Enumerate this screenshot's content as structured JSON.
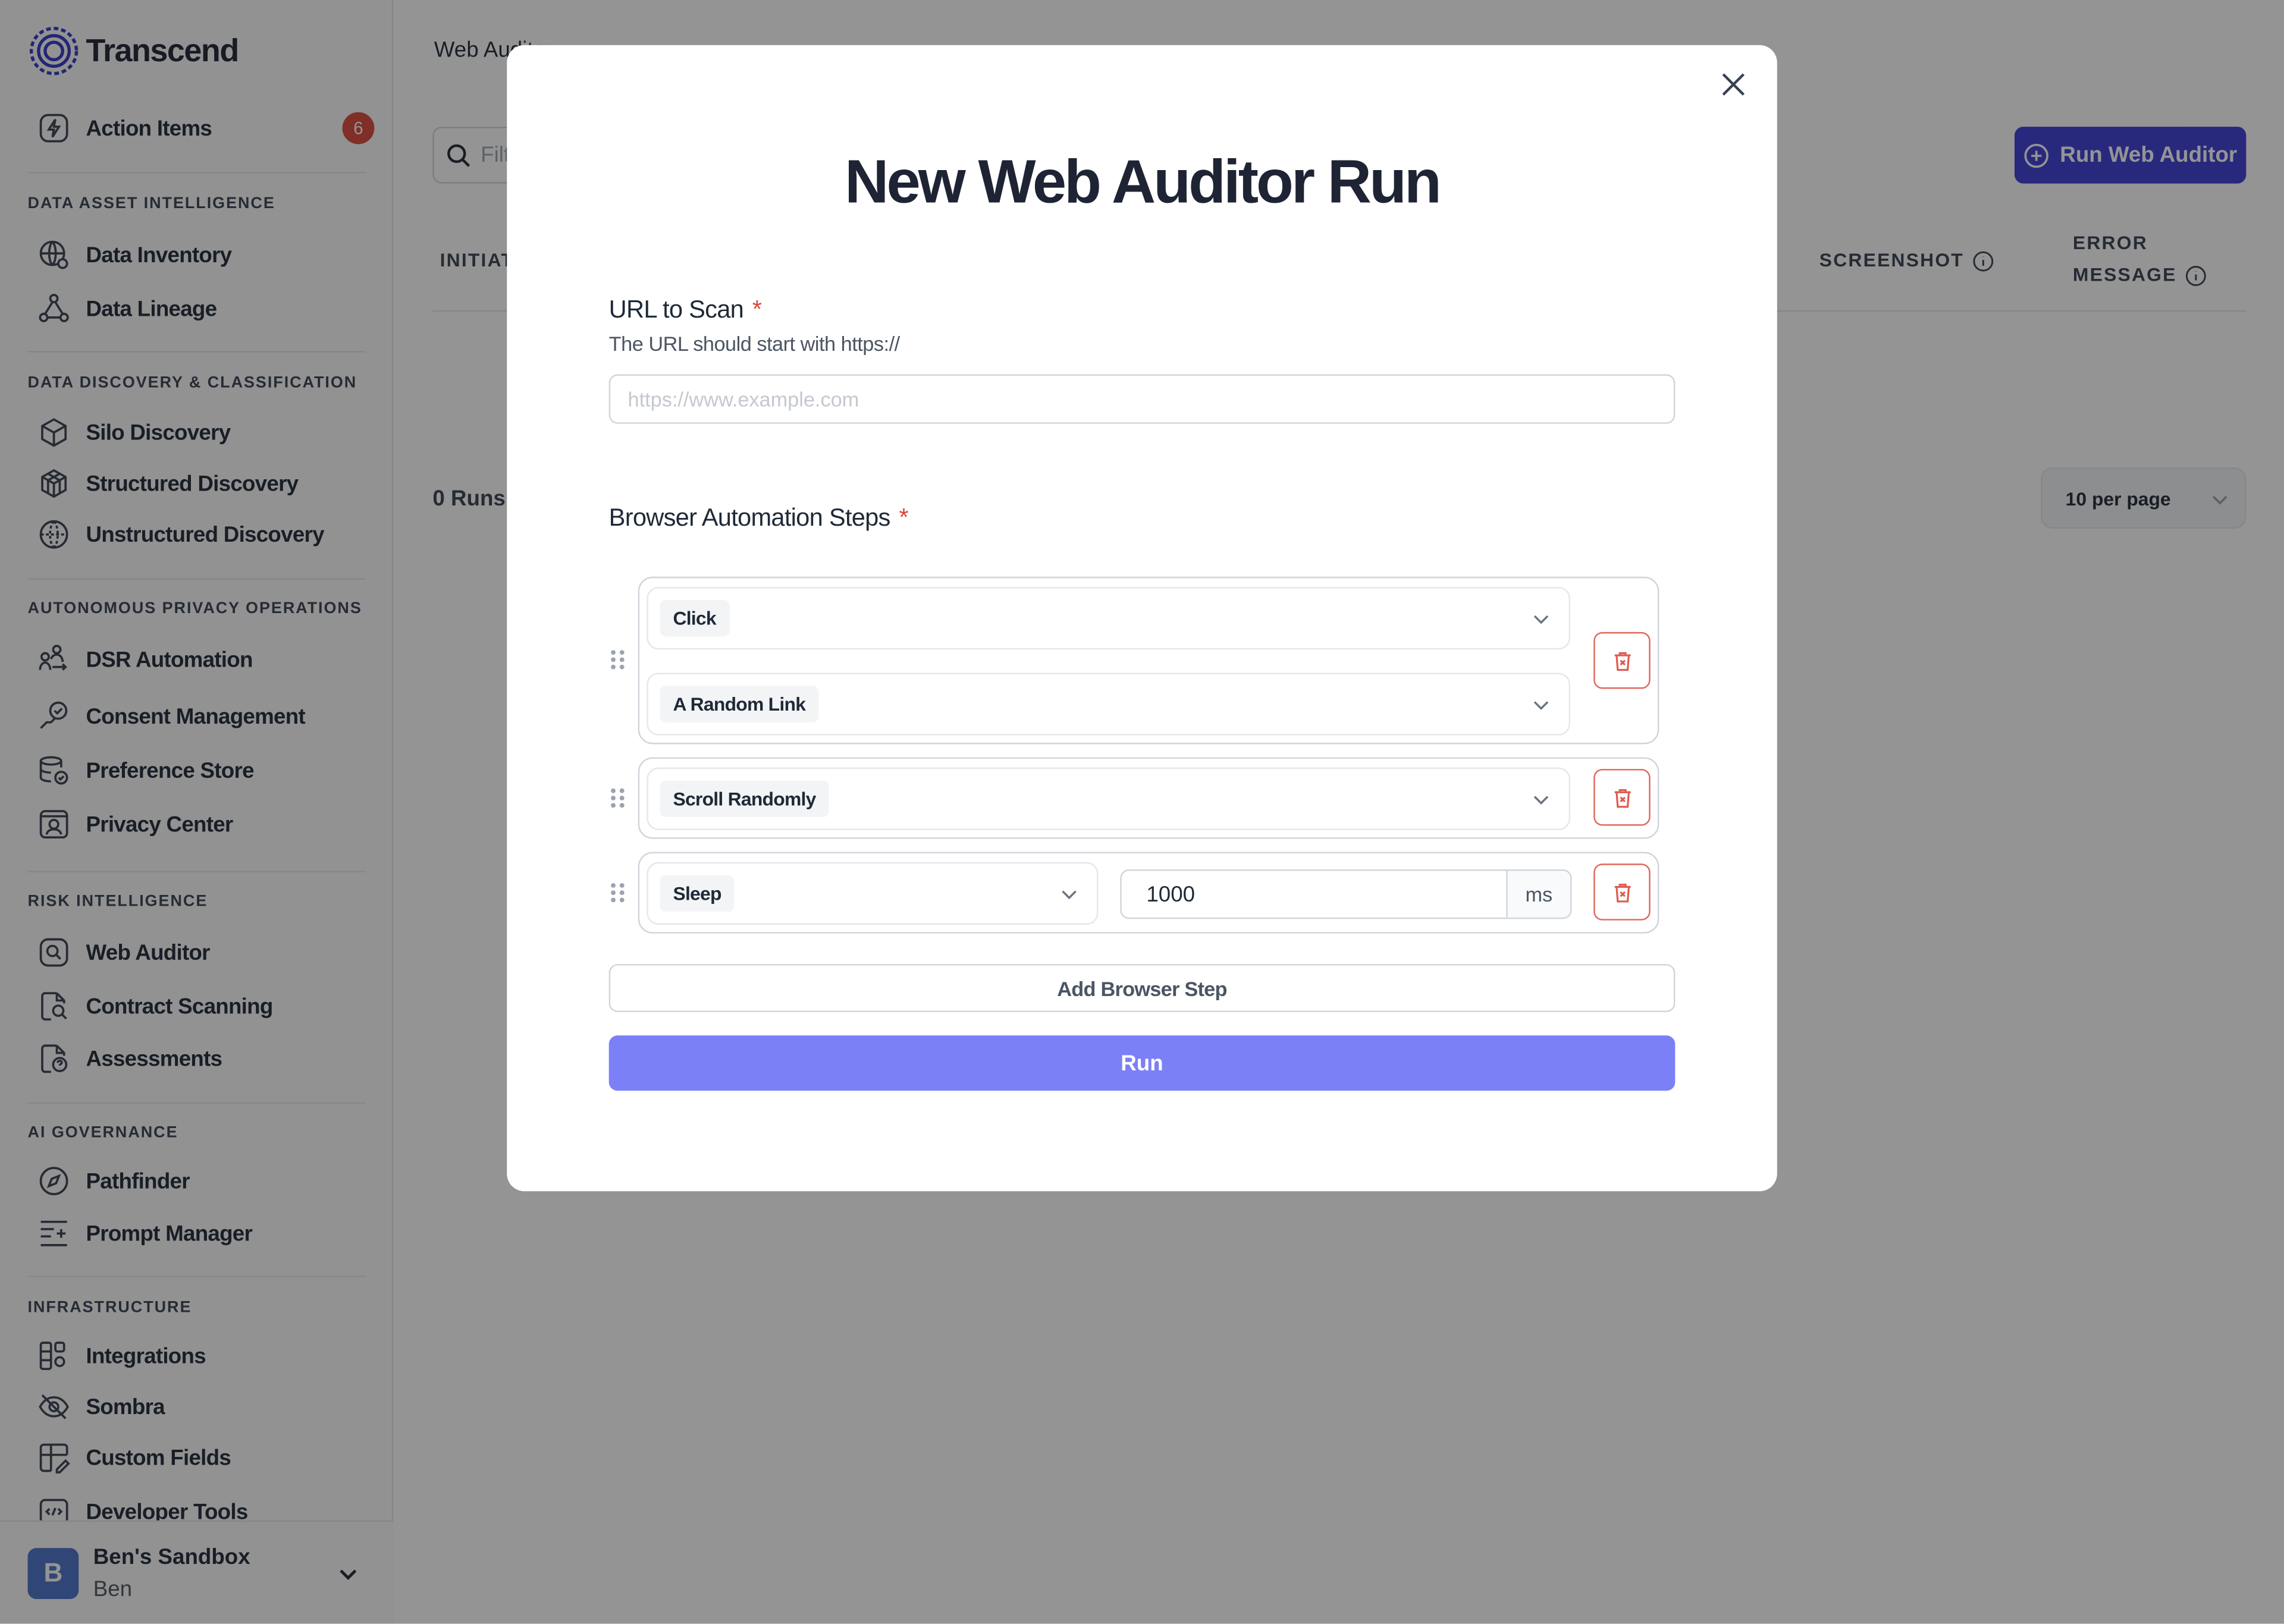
{
  "brand": {
    "name": "Transcend"
  },
  "sidebar": {
    "action_items": {
      "label": "Action Items",
      "badge": "6"
    },
    "sections": [
      {
        "title": "DATA ASSET INTELLIGENCE",
        "items": [
          {
            "label": "Data Inventory",
            "icon": "globe-gear-icon"
          },
          {
            "label": "Data Lineage",
            "icon": "lineage-nodes-icon"
          }
        ]
      },
      {
        "title": "DATA DISCOVERY & CLASSIFICATION",
        "items": [
          {
            "label": "Silo Discovery",
            "icon": "cube-icon"
          },
          {
            "label": "Structured Discovery",
            "icon": "cube-grid-icon"
          },
          {
            "label": "Unstructured Discovery",
            "icon": "globe-dashed-icon"
          }
        ]
      },
      {
        "title": "AUTONOMOUS PRIVACY OPERATIONS",
        "items": [
          {
            "label": "DSR Automation",
            "icon": "people-network-icon"
          },
          {
            "label": "Consent Management",
            "icon": "consent-check-icon"
          },
          {
            "label": "Preference Store",
            "icon": "database-check-icon"
          },
          {
            "label": "Privacy Center",
            "icon": "user-card-icon"
          }
        ]
      },
      {
        "title": "RISK INTELLIGENCE",
        "items": [
          {
            "label": "Web Auditor",
            "icon": "search-square-icon"
          },
          {
            "label": "Contract Scanning",
            "icon": "document-search-icon"
          },
          {
            "label": "Assessments",
            "icon": "document-question-icon"
          }
        ]
      },
      {
        "title": "AI GOVERNANCE",
        "items": [
          {
            "label": "Pathfinder",
            "icon": "compass-icon"
          },
          {
            "label": "Prompt Manager",
            "icon": "prompt-lines-icon"
          }
        ]
      },
      {
        "title": "INFRASTRUCTURE",
        "items": [
          {
            "label": "Integrations",
            "icon": "integrations-grid-icon"
          },
          {
            "label": "Sombra",
            "icon": "eye-off-icon"
          },
          {
            "label": "Custom Fields",
            "icon": "layout-edit-icon"
          },
          {
            "label": "Developer Tools",
            "icon": "code-window-icon"
          }
        ]
      }
    ],
    "account": {
      "initial": "B",
      "name": "Ben's Sandbox",
      "user": "Ben"
    }
  },
  "main": {
    "breadcrumb": "Web Auditor",
    "filter_placeholder": "Filter",
    "run_button": "Run Web Auditor",
    "columns": {
      "initiated": "INITIATED",
      "screenshot": "SCREENSHOT",
      "error_line1": "ERROR",
      "error_line2": "MESSAGE"
    },
    "runs_count": "0 Runs",
    "per_page": "10 per page"
  },
  "modal": {
    "title": "New Web Auditor Run",
    "url_label": "URL to Scan",
    "required_mark": "*",
    "url_help": "The URL should start with https://",
    "url_placeholder": "https://www.example.com",
    "steps_label": "Browser Automation Steps",
    "steps": [
      {
        "action": "Click",
        "target": "A Random Link"
      },
      {
        "action": "Scroll Randomly"
      },
      {
        "action": "Sleep",
        "value": "1000",
        "unit": "ms"
      }
    ],
    "add_step": "Add Browser Step",
    "run": "Run"
  },
  "colors": {
    "accent": "#3b3dd6",
    "run_button": "#7c80f7",
    "danger": "#d9483b"
  }
}
